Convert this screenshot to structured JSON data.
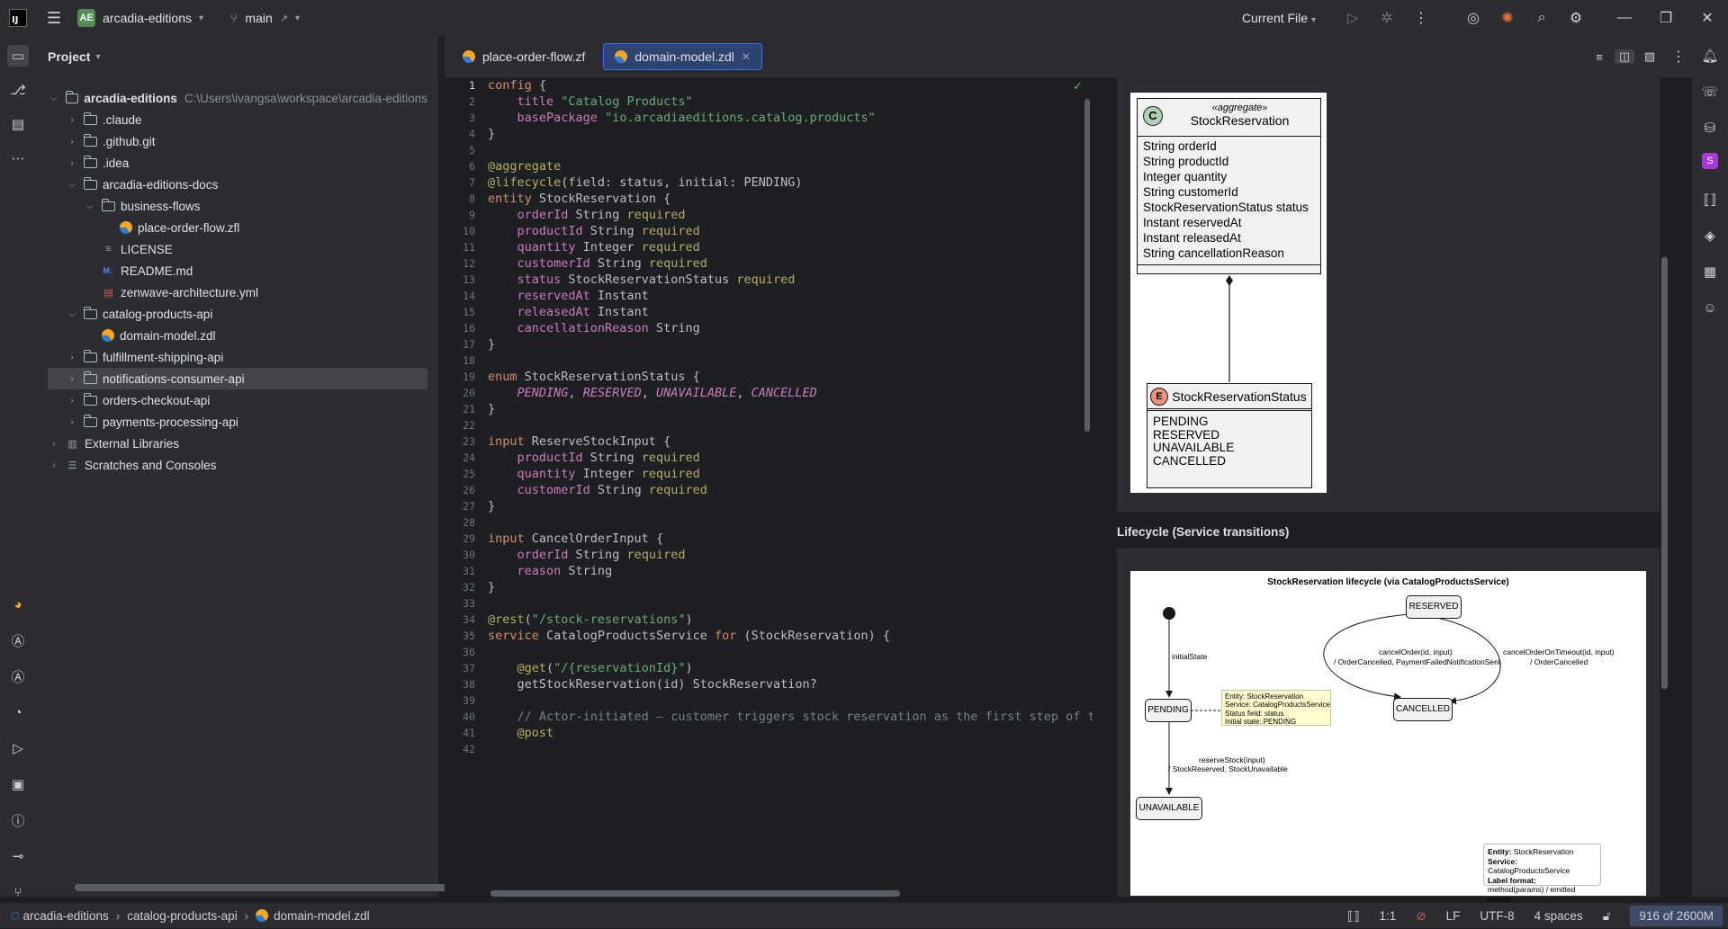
{
  "titlebar": {
    "logo": "IJ",
    "project_badge": "AE",
    "project_name": "arcadia-editions",
    "branch": "main",
    "branch_arrow": "↗",
    "run_config": "Current File"
  },
  "project_panel": {
    "title": "Project",
    "tree": [
      {
        "label": "arcadia-editions",
        "path": "C:\\Users\\ivangsa\\workspace\\arcadia-editions",
        "depth": 0,
        "type": "folder",
        "open": true
      },
      {
        "label": ".claude",
        "depth": 1,
        "type": "folder",
        "open": false
      },
      {
        "label": ".github.git",
        "depth": 1,
        "type": "folder",
        "open": false
      },
      {
        "label": ".idea",
        "depth": 1,
        "type": "folder",
        "open": false
      },
      {
        "label": "arcadia-editions-docs",
        "depth": 1,
        "type": "folder",
        "open": true
      },
      {
        "label": "business-flows",
        "depth": 2,
        "type": "folder",
        "open": true
      },
      {
        "label": "place-order-flow.zfl",
        "depth": 3,
        "type": "zfile"
      },
      {
        "label": "LICENSE",
        "depth": 2,
        "type": "text"
      },
      {
        "label": "README.md",
        "depth": 2,
        "type": "md"
      },
      {
        "label": "zenwave-architecture.yml",
        "depth": 2,
        "type": "yml"
      },
      {
        "label": "catalog-products-api",
        "depth": 1,
        "type": "folder",
        "open": true
      },
      {
        "label": "domain-model.zdl",
        "depth": 2,
        "type": "zfile"
      },
      {
        "label": "fulfillment-shipping-api",
        "depth": 1,
        "type": "folder",
        "open": false
      },
      {
        "label": "notifications-consumer-api",
        "depth": 1,
        "type": "folder",
        "open": false,
        "selected": true
      },
      {
        "label": "orders-checkout-api",
        "depth": 1,
        "type": "folder",
        "open": false
      },
      {
        "label": "payments-processing-api",
        "depth": 1,
        "type": "folder",
        "open": false
      },
      {
        "label": "External Libraries",
        "depth": 0,
        "type": "lib",
        "open": false
      },
      {
        "label": "Scratches and Consoles",
        "depth": 0,
        "type": "scratch",
        "open": false
      }
    ]
  },
  "tabs": [
    {
      "label": "place-order-flow.zf",
      "active": false
    },
    {
      "label": "domain-model.zdl",
      "active": true
    }
  ],
  "code_lines": [
    "config {",
    "    title \"Catalog Products\"",
    "    basePackage \"io.arcadiaeditions.catalog.products\"",
    "}",
    "",
    "@aggregate",
    "@lifecycle(field: status, initial: PENDING)",
    "entity StockReservation {",
    "    orderId String required",
    "    productId String required",
    "    quantity Integer required",
    "    customerId String required",
    "    status StockReservationStatus required",
    "    reservedAt Instant",
    "    releasedAt Instant",
    "    cancellationReason String",
    "}",
    "",
    "enum StockReservationStatus {",
    "    PENDING, RESERVED, UNAVAILABLE, CANCELLED",
    "}",
    "",
    "input ReserveStockInput {",
    "    productId String required",
    "    quantity Integer required",
    "    customerId String required",
    "}",
    "",
    "input CancelOrderInput {",
    "    orderId String required",
    "    reason String",
    "}",
    "",
    "@rest(\"/stock-reservations\")",
    "service CatalogProductsService for (StockReservation) {",
    "",
    "    @get(\"/{reservationId}\")",
    "    getStockReservation(id) StockReservation?",
    "",
    "    // Actor-initiated — customer triggers stock reservation as the first step of th",
    "    @post",
    ""
  ],
  "preview": {
    "class_diagram": {
      "entity": {
        "stereotype": "«aggregate»",
        "name": "StockReservation",
        "icon": "C",
        "fields": [
          "String orderId",
          "String productId",
          "Integer quantity",
          "String customerId",
          "StockReservationStatus status",
          "Instant reservedAt",
          "Instant releasedAt",
          "String cancellationReason"
        ]
      },
      "enum": {
        "name": "StockReservationStatus",
        "icon": "E",
        "values": [
          "PENDING",
          "RESERVED",
          "UNAVAILABLE",
          "CANCELLED"
        ]
      }
    },
    "lifecycle_heading": "Lifecycle (Service transitions)",
    "state_diagram": {
      "title": "StockReservation lifecycle (via CatalogProductsService)",
      "states": [
        "RESERVED",
        "PENDING",
        "CANCELLED",
        "UNAVAILABLE"
      ],
      "initial_label": "initialState",
      "cancel_label_1": "cancelOrder(id, input)",
      "cancel_label_2": "/ OrderCancelled, PaymentFailedNotificationSent",
      "timeout_label_1": "cancelOrderOnTimeout(id, input)",
      "timeout_label_2": "/ OrderCancelled",
      "reserve_label_1": "reserveStock(input)",
      "reserve_label_2": "/ StockReserved, StockUnavailable",
      "note": [
        "Entity: StockReservation",
        "Service: CatalogProductsService",
        "Status field: status",
        "Initial state: PENDING"
      ],
      "legend": {
        "entity_key": "Entity:",
        "entity_val": "StockReservation",
        "service_key": "Service:",
        "service_val": "CatalogProductsService",
        "label_key": "Label format:",
        "label_val": "method(params) / emitted events"
      }
    }
  },
  "statusbar": {
    "breadcrumb": [
      "arcadia-editions",
      "catalog-products-api",
      "domain-model.zdl"
    ],
    "position": "1:1",
    "line_sep": "LF",
    "encoding": "UTF-8",
    "indent": "4 spaces",
    "memory": "916 of 2600M"
  },
  "colors": {
    "accent": "#3574f0",
    "bg": "#1e1f22",
    "panel": "#2b2d30"
  }
}
